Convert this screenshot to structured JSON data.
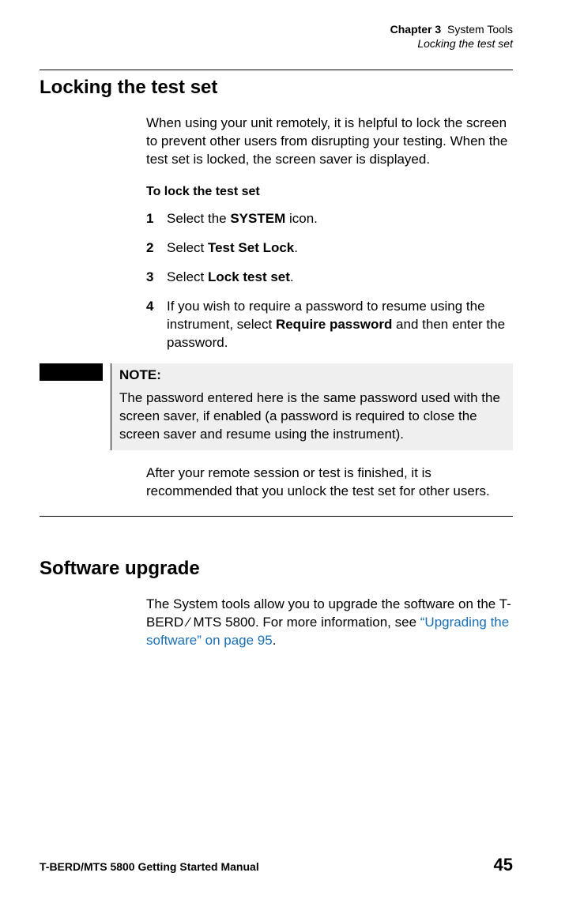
{
  "header": {
    "chapter_label": "Chapter 3",
    "chapter_title": "System Tools",
    "section": "Locking the test set"
  },
  "section1": {
    "heading": "Locking the test set",
    "intro": "When using your unit remotely, it is helpful to lock the screen to prevent other users from disrupting your testing. When the test set is locked, the screen saver is displayed.",
    "sub": "To lock the test set",
    "steps": [
      {
        "num": "1",
        "pre": "Select the ",
        "b": "SYSTEM",
        "post": " icon."
      },
      {
        "num": "2",
        "pre": "Select ",
        "b": "Test Set Lock",
        "post": "."
      },
      {
        "num": "3",
        "pre": "Select ",
        "b": "Lock test set",
        "post": "."
      },
      {
        "num": "4",
        "pre": "If you wish to require a password to resume using the instrument, select ",
        "b": "Require password",
        "post": " and then enter the password."
      }
    ],
    "note": {
      "title": "NOTE:",
      "text": "The password entered here is the same password used with the screen saver, if enabled (a password is required to close the screen saver and resume using the instrument)."
    },
    "outro": "After your remote session or test is finished, it is recommended that you unlock the test set for other users."
  },
  "section2": {
    "heading": "Software upgrade",
    "text_pre": "The System tools allow you to upgrade the software on the T-BERD ⁄ MTS 5800. For more information, see ",
    "link": "“Upgrading the software” on page 95",
    "text_post": "."
  },
  "footer": {
    "left": "T-BERD/MTS 5800 Getting Started Manual",
    "right": "45"
  }
}
